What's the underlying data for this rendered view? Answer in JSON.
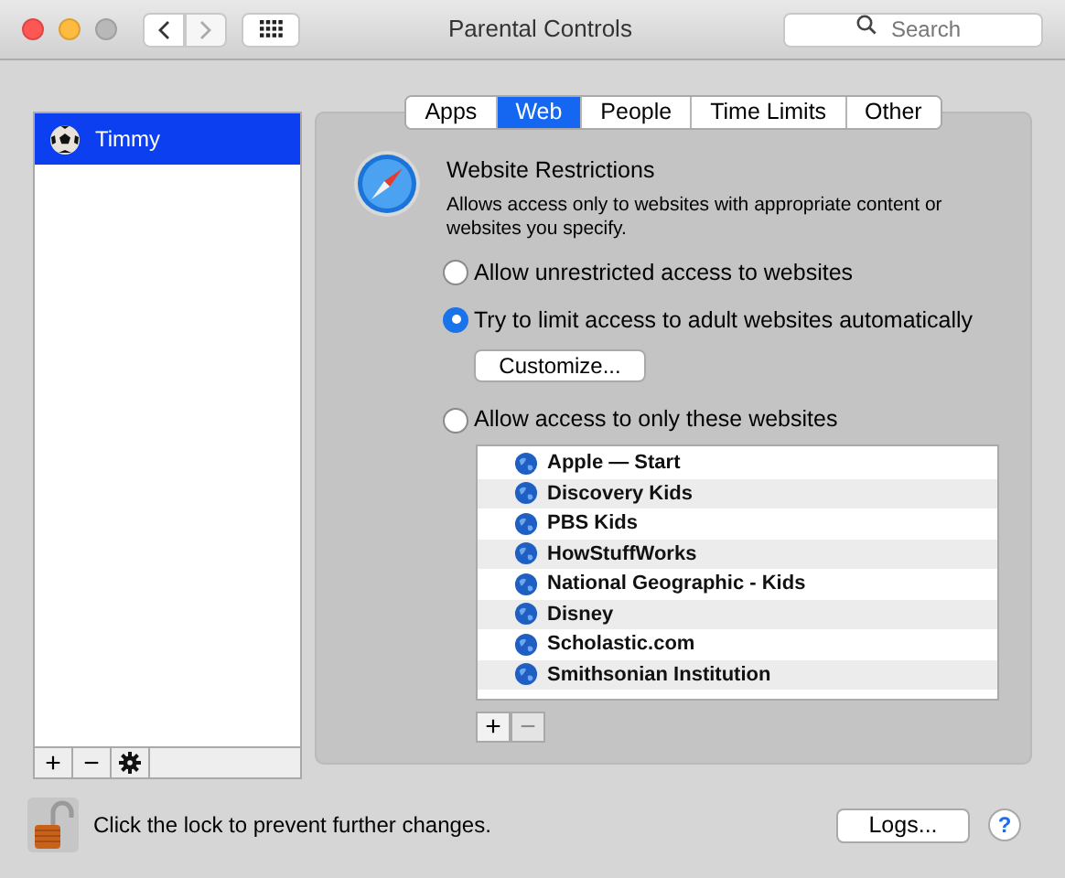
{
  "window": {
    "title": "Parental Controls",
    "search": {
      "placeholder": "Search"
    }
  },
  "sidebar": {
    "users": [
      {
        "name": "Timmy",
        "selected": true
      }
    ],
    "buttons": [
      "+",
      "−"
    ]
  },
  "tabs": [
    {
      "label": "Apps",
      "selected": false
    },
    {
      "label": "Web",
      "selected": true
    },
    {
      "label": "People",
      "selected": false
    },
    {
      "label": "Time Limits",
      "selected": false
    },
    {
      "label": "Other",
      "selected": false
    }
  ],
  "section": {
    "title": "Website Restrictions",
    "description": "Allows access only to websites with appropriate content or websites you specify."
  },
  "options": [
    {
      "label": "Allow unrestricted access to websites",
      "selected": false
    },
    {
      "label": "Try to limit access to adult websites automatically",
      "selected": true
    },
    {
      "label": "Allow access to only these websites",
      "selected": false
    }
  ],
  "customize_button": "Customize...",
  "websites": [
    "Apple — Start",
    "Discovery Kids",
    "PBS Kids",
    "HowStuffWorks",
    "National Geographic - Kids",
    "Disney",
    "Scholastic.com",
    "Smithsonian Institution"
  ],
  "list_buttons": [
    {
      "label": "+",
      "disabled": false
    },
    {
      "label": "−",
      "disabled": true
    }
  ],
  "footer": {
    "lock_text": "Click the lock to prevent further changes.",
    "logs_button": "Logs...",
    "help": "?"
  }
}
